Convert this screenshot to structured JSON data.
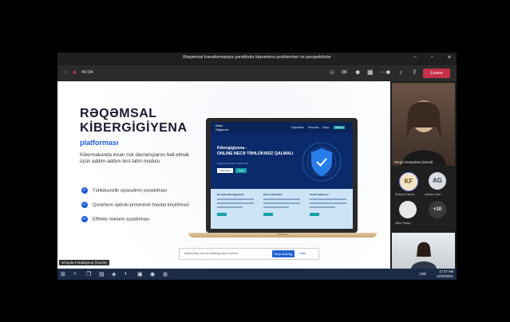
{
  "window": {
    "title": "Rəqəmsal transformasiya şəraitində idarəetmə problemləri və perspektivlər",
    "minimize_icon": "minimize-icon",
    "maximize_icon": "maximize-icon",
    "close_icon": "close-icon"
  },
  "toolbar": {
    "timer": "40:34",
    "leave_label": "Leave"
  },
  "slide": {
    "title_line1": "RƏQƏMSAL",
    "title_line2": "KİBERGİGİYENA",
    "subtitle": "platforması",
    "description": "Kibermәkanda insan risk davranışlarını həll etmək üçün addım-addım test təlim modulu",
    "bullets": [
      "Təhlükəsizlik siyasətinin yaradılması",
      "Qərarların qəbulu prosesinin həyata keçirilməsi",
      "Effektiv risklərin azaldılması"
    ],
    "laptop_screen": {
      "logo_line1": "Kiber",
      "logo_line2": "Gigiyena",
      "nav": [
        "Təqdimatlar",
        "Resurslar",
        "Əlaqə",
        "Daxil ol"
      ],
      "headline1": "Kibergigiyena -",
      "headline2": "ONLINE NECƏ TƏHLÜKƏSİZ QALMALI",
      "small_text": "Onlayn kurs təlim platforması",
      "btn1": "Təlimə keç",
      "btn2": "Daxil",
      "cards": [
        "Nə üçün kibergigiyena?",
        "Kimi istiqamətlər",
        "Hədəf auditoriya"
      ],
      "base_label": "MacBook"
    }
  },
  "share_banner": {
    "text": "teams.live.com is sharing your screen.",
    "stop_label": "Stop sharing",
    "hide_label": "Hide"
  },
  "presenter_label": "Shəyda Fətullayeva (Guest)",
  "participants": {
    "top_tile_label": "Nərgiz İsmayılova (Guest)",
    "avatars": [
      {
        "initials": "KF",
        "name": "Shayda Fatulla...",
        "bg": "#f2e3c5",
        "fg": "#6b4a1a"
      },
      {
        "initials": "AG",
        "name": "Aykhan Qad...",
        "bg": "#d9dde3",
        "fg": "#3b4250"
      },
      {
        "initials": "",
        "name": "Ulker Sadiq...",
        "bg": "#e8e8e8",
        "fg": "#444"
      },
      {
        "initials": "+10",
        "name": "",
        "bg": "#3a3a3a",
        "fg": "#fff"
      }
    ]
  },
  "taskbar": {
    "time": "17:27 AM",
    "date": "12/22/2021",
    "tray_text": "AZE"
  },
  "colors": {
    "accent": "#1f5bd6",
    "leave": "#c4314b",
    "stop_sharing": "#2563d4"
  }
}
